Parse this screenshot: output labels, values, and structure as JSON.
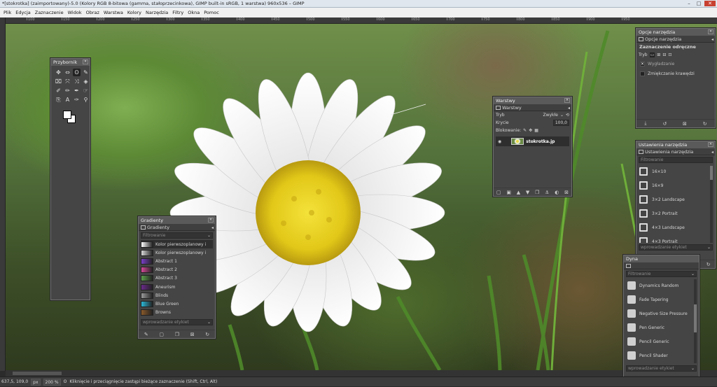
{
  "window": {
    "title": "*[stokrotka] (zaimportowany)-5.0 (Kolory RGB 8-bitowa (gamma, stałoprzecinkowa), GIMP built-in sRGB, 1 warstwa) 960x536 – GIMP",
    "minimize": "–",
    "maximize": "□",
    "close": "✕"
  },
  "menu": [
    "Plik",
    "Edycja",
    "Zaznaczenie",
    "Widok",
    "Obraz",
    "Warstwa",
    "Kolory",
    "Narzędzia",
    "Filtry",
    "Okna",
    "Pomoc"
  ],
  "ruler": [
    "100",
    "150",
    "200",
    "250",
    "300",
    "350",
    "400",
    "450",
    "500",
    "550",
    "600",
    "650",
    "700",
    "750",
    "800",
    "850",
    "900",
    "950"
  ],
  "toolbox": {
    "title": "Przybornik",
    "close": "×"
  },
  "tool_icons": [
    "move-icon",
    "align-icon",
    "free-select-icon",
    "fuzzy-select-icon",
    "crop-icon",
    "transform-icon",
    "warp-icon",
    "bucket-fill-icon",
    "paint-icon",
    "brush-icon",
    "airbrush-icon",
    "smudge-icon",
    "clone-icon",
    "text-icon",
    "color-picker-icon",
    "zoom-icon"
  ],
  "tool_glyphs": [
    "✥",
    "⇔",
    "ʘ",
    "✎",
    "⌧",
    "⤧",
    "⤨",
    "◈",
    "✐",
    "✏",
    "✒",
    "☞",
    "⎘",
    "A",
    "✑",
    "⚲"
  ],
  "gradients": {
    "title": "Gradienty",
    "tab": "Gradienty",
    "filter_placeholder": "Filtrowanie",
    "tags_placeholder": "wprowadzanie etykiet",
    "items": [
      {
        "name": "Kolor pierwszoplanowy i",
        "color": "#ffffff"
      },
      {
        "name": "Kolor pierwszoplanowy i",
        "color": "#d8d8d8"
      },
      {
        "name": "Abstract 1",
        "color": "#7a3fc8"
      },
      {
        "name": "Abstract 2",
        "color": "#d64a9a"
      },
      {
        "name": "Abstract 3",
        "color": "#5ba04a"
      },
      {
        "name": "Aneurism",
        "color": "#6a2a8a"
      },
      {
        "name": "Blinds",
        "color": "#9a9a9a"
      },
      {
        "name": "Blue Green",
        "color": "#2ab8d8"
      },
      {
        "name": "Browns",
        "color": "#8a5a2a"
      }
    ]
  },
  "layers": {
    "title": "Warstwy",
    "tab": "Warstwy",
    "mode_label": "Tryb",
    "mode_value": "Zwykłe",
    "opacity_label": "Krycie",
    "opacity_value": "100,0",
    "lock_label": "Blokowanie:",
    "layer_name": "stokrotka.jp"
  },
  "tool_options": {
    "title": "Opcje narzędzia",
    "tab": "Opcje narzędzia",
    "tool_name": "Zaznaczenie odręczne",
    "mode_label": "Tryb",
    "antialias": "Wygładzanie",
    "feather": "Zmiękczanie krawędzi"
  },
  "tool_presets": {
    "title": "Ustawienia narzędzia",
    "tab": "Ustawienia narzędzia",
    "filter_placeholder": "Filtrowanie",
    "tags_placeholder": "wprowadzanie etykiet",
    "items": [
      "16×10",
      "16×9",
      "3×2 Landscape",
      "3×2 Portrait",
      "4×3 Landscape",
      "4×3 Portrait"
    ]
  },
  "dynamics": {
    "title": "Dyna",
    "filter_placeholder": "Filtrowanie",
    "tags_placeholder": "wprowadzanie etykiet",
    "items": [
      "Dynamics Random",
      "Fade Tapering",
      "Negative Size Pressure",
      "Pen Generic",
      "Pencil Generic",
      "Pencil Shader"
    ]
  },
  "status": {
    "coords": "637,5, 109,0",
    "unit": "px",
    "zoom": "200 %",
    "message": "Kliknięcie i przeciągnięcie zastąpi bieżące zaznaczenie (Shift, Ctrl, Alt)"
  }
}
